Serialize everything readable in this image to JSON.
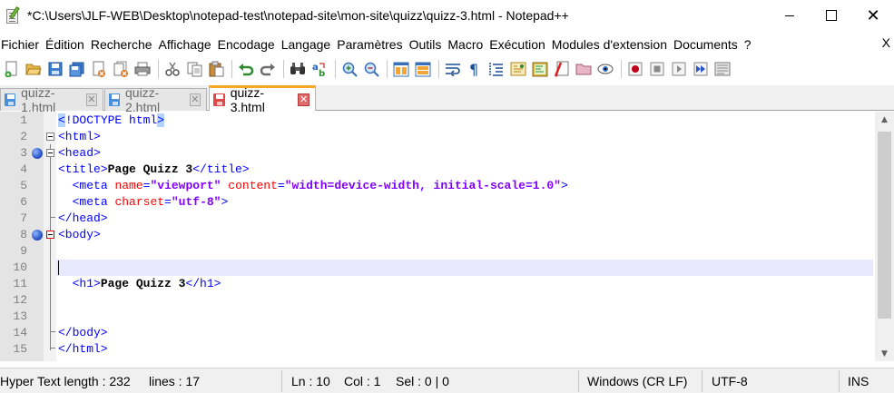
{
  "window": {
    "title": "*C:\\Users\\JLF-WEB\\Desktop\\notepad-test\\notepad-site\\mon-site\\quizz\\quizz-3.html - Notepad++",
    "minimize_icon": "minimize-icon",
    "maximize_icon": "maximize-icon",
    "close_label": "✕"
  },
  "menu": {
    "items": [
      "Fichier",
      "Édition",
      "Recherche",
      "Affichage",
      "Encodage",
      "Langage",
      "Paramètres",
      "Outils",
      "Macro",
      "Exécution",
      "Modules d'extension",
      "Documents",
      "?"
    ],
    "close_label": "X"
  },
  "toolbar": {
    "icons": [
      "new-file-icon",
      "open-file-icon",
      "save-icon",
      "save-all-icon",
      "close-icon",
      "close-all-icon",
      "print-icon",
      "cut-icon",
      "copy-icon",
      "paste-icon",
      "undo-icon",
      "redo-icon",
      "find-icon",
      "replace-icon",
      "zoom-in-icon",
      "zoom-out-icon",
      "sync-vertical-icon",
      "sync-horizontal-icon",
      "word-wrap-icon",
      "show-all-chars-icon",
      "indent-guide-icon",
      "function-list-icon",
      "document-map-icon",
      "doc-switcher-icon",
      "folder-workspace-icon",
      "monitoring-icon",
      "record-macro-icon",
      "stop-record-icon",
      "play-macro-icon",
      "run-multiple-macro-icon",
      "save-macro-icon"
    ]
  },
  "tabs": [
    {
      "label": "quizz-1.html",
      "active": false,
      "close": "✕"
    },
    {
      "label": "quizz-2.html",
      "active": false,
      "close": "✕"
    },
    {
      "label": "quizz-3.html",
      "active": true,
      "close": "✕"
    }
  ],
  "editor": {
    "current_line": 10,
    "lines": [
      {
        "n": "1",
        "text": "<!DOCTYPE html>"
      },
      {
        "n": "2",
        "text": "<html>"
      },
      {
        "n": "3",
        "text": "<head>"
      },
      {
        "n": "4",
        "text": "<title>Page Quizz 3</title>"
      },
      {
        "n": "5",
        "text": "  <meta name=\"viewport\" content=\"width=device-width, initial-scale=1.0\">"
      },
      {
        "n": "6",
        "text": "  <meta charset=\"utf-8\">"
      },
      {
        "n": "7",
        "text": "</head>"
      },
      {
        "n": "8",
        "text": "<body>"
      },
      {
        "n": "9",
        "text": ""
      },
      {
        "n": "10",
        "text": ""
      },
      {
        "n": "11",
        "text": "  <h1>Page Quizz 3</h1>"
      },
      {
        "n": "12",
        "text": ""
      },
      {
        "n": "13",
        "text": ""
      },
      {
        "n": "14",
        "text": "</body>"
      },
      {
        "n": "15",
        "text": "</html>"
      }
    ]
  },
  "status": {
    "file_type": "Hyper Text length : 232",
    "lines": "lines : 17",
    "ln": "Ln : 10",
    "col": "Col : 1",
    "sel": "Sel : 0 | 0",
    "eol": "Windows (CR LF)",
    "encoding": "UTF-8",
    "mode": "INS"
  }
}
